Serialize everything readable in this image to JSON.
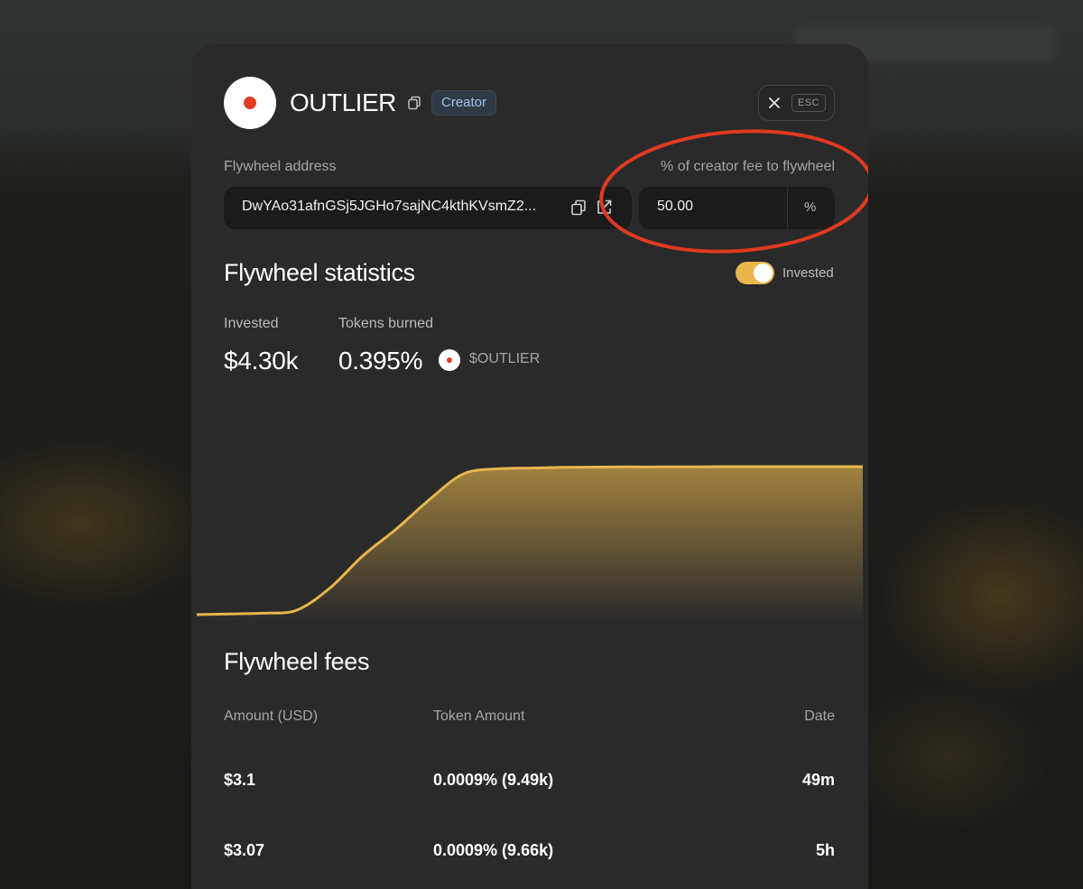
{
  "header": {
    "token_name": "OUTLIER",
    "role_badge": "Creator",
    "close_key": "ESC",
    "icons": {
      "avatar": "red-dot-logo",
      "copy": "copy-icon",
      "close": "close-icon"
    }
  },
  "flywheel_address": {
    "label": "Flywheel address",
    "value": "DwYAo31afnGSj5JGHo7sajNC4kthKVsmZ2...",
    "icons": [
      "copy-icon",
      "external-link-icon"
    ]
  },
  "creator_fee": {
    "label": "% of creator fee to flywheel",
    "value": "50.00",
    "unit": "%"
  },
  "statistics": {
    "title": "Flywheel statistics",
    "toggle_label": "Invested",
    "toggle_on": true,
    "invested_label": "Invested",
    "invested_value": "$4.30k",
    "burned_label": "Tokens burned",
    "burned_value": "0.395%",
    "ticker": "$OUTLIER"
  },
  "chart_data": {
    "type": "area",
    "title": "",
    "xlabel": "",
    "ylabel": "",
    "grid": false,
    "color": "#e8b64d",
    "x": [
      0,
      1,
      2,
      3,
      4,
      5,
      6,
      7,
      8,
      9,
      10,
      11,
      12,
      13,
      14,
      15,
      16,
      17,
      18,
      19,
      20
    ],
    "y": [
      0.0,
      0.005,
      0.01,
      0.03,
      0.18,
      0.4,
      0.58,
      0.78,
      0.95,
      0.985,
      0.99,
      0.995,
      0.997,
      0.998,
      0.998,
      0.999,
      1.0,
      1.0,
      1.0,
      1.0,
      1.0
    ],
    "ylim": [
      0,
      1
    ]
  },
  "fees": {
    "title": "Flywheel fees",
    "columns": [
      "Amount (USD)",
      "Token Amount",
      "Date"
    ],
    "rows": [
      {
        "amount": "$3.1",
        "token_amount": "0.0009% (9.49k)",
        "date": "49m"
      },
      {
        "amount": "$3.07",
        "token_amount": "0.0009% (9.66k)",
        "date": "5h"
      }
    ]
  },
  "colors": {
    "accent": "#e8b64d",
    "annotation": "#e03a22",
    "badge_text": "#9ec6f0",
    "panel": "#2a2a2a"
  }
}
